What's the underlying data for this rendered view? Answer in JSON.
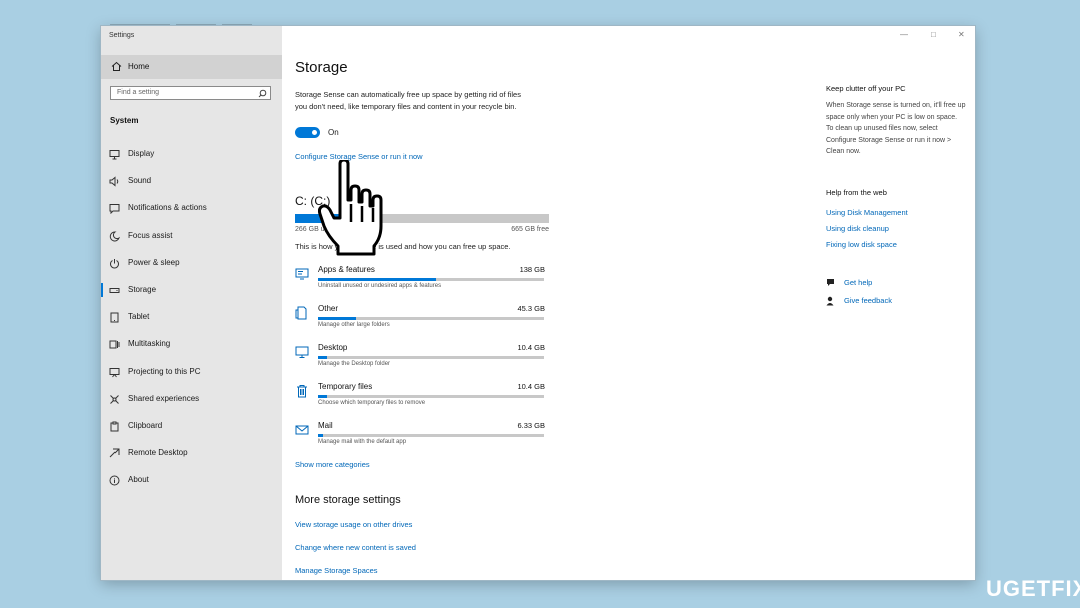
{
  "window": {
    "app_title": "Settings"
  },
  "sidebar": {
    "home_label": "Home",
    "search_placeholder": "Find a setting",
    "section_label": "System",
    "items": [
      {
        "label": "Display",
        "icon": "display-icon"
      },
      {
        "label": "Sound",
        "icon": "sound-icon"
      },
      {
        "label": "Notifications & actions",
        "icon": "notifications-icon"
      },
      {
        "label": "Focus assist",
        "icon": "moon-icon"
      },
      {
        "label": "Power & sleep",
        "icon": "power-icon"
      },
      {
        "label": "Storage",
        "icon": "storage-icon",
        "active": true
      },
      {
        "label": "Tablet",
        "icon": "tablet-icon"
      },
      {
        "label": "Multitasking",
        "icon": "multitasking-icon"
      },
      {
        "label": "Projecting to this PC",
        "icon": "projecting-icon"
      },
      {
        "label": "Shared experiences",
        "icon": "shared-icon"
      },
      {
        "label": "Clipboard",
        "icon": "clipboard-icon"
      },
      {
        "label": "Remote Desktop",
        "icon": "remote-desktop-icon"
      },
      {
        "label": "About",
        "icon": "info-icon"
      }
    ]
  },
  "main": {
    "title": "Storage",
    "description": "Storage Sense can automatically free up space by getting rid of files you don't need, like temporary files and content in your recycle bin.",
    "toggle_label": "On",
    "configure_link": "Configure Storage Sense or run it now",
    "drive": {
      "title": "C: (C:)",
      "used_label": "266 GB used",
      "free_label": "665 GB free",
      "used_fraction": 0.29
    },
    "usage_description": "This is how your storage is used and how you can free up space.",
    "categories": [
      {
        "name": "Apps & features",
        "size": "138 GB",
        "sub": "Uninstall unused or undesired apps & features",
        "fraction": 0.52,
        "icon": "apps-icon"
      },
      {
        "name": "Other",
        "size": "45.3 GB",
        "sub": "Manage other large folders",
        "fraction": 0.17,
        "icon": "other-icon"
      },
      {
        "name": "Desktop",
        "size": "10.4 GB",
        "sub": "Manage the Desktop folder",
        "fraction": 0.04,
        "icon": "desktop-icon"
      },
      {
        "name": "Temporary files",
        "size": "10.4 GB",
        "sub": "Choose which temporary files to remove",
        "fraction": 0.04,
        "icon": "trash-icon"
      },
      {
        "name": "Mail",
        "size": "6.33 GB",
        "sub": "Manage mail with the default app",
        "fraction": 0.02,
        "icon": "mail-icon"
      }
    ],
    "show_more": "Show more categories",
    "more_settings_title": "More storage settings",
    "more_links": [
      "View storage usage on other drives",
      "Change where new content is saved",
      "Manage Storage Spaces"
    ]
  },
  "right_panel": {
    "clutter_title": "Keep clutter off your PC",
    "clutter_text": "When Storage sense is turned on, it'll free up space only when your PC is low on space. To clean up unused files now, select Configure Storage Sense or run it now > Clean now.",
    "help_title": "Help from the web",
    "help_links": [
      "Using Disk Management",
      "Using disk cleanup",
      "Fixing low disk space"
    ],
    "get_help": "Get help",
    "give_feedback": "Give feedback"
  },
  "watermark": "UGETFIX",
  "colors": {
    "accent": "#0078d7",
    "link": "#0067b8",
    "sidebar_bg": "#e6e6e6",
    "desktop_bg": "#a9cfe3"
  }
}
